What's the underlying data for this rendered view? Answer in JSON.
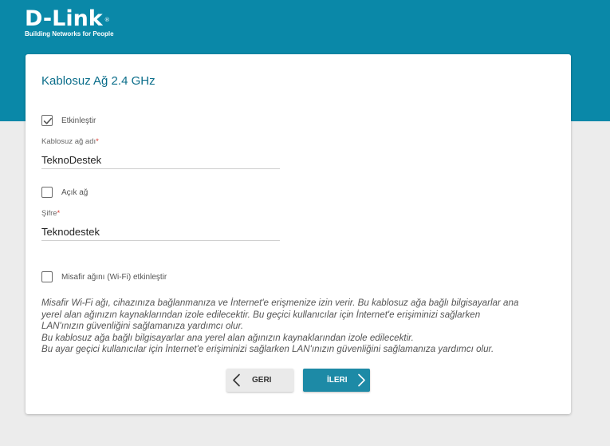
{
  "brand": {
    "logo_text": "D-Link",
    "registered_mark": "®",
    "tagline": "Building Networks for People"
  },
  "wizard": {
    "title": "Kablosuz Ağ 2.4 GHz",
    "enable": {
      "label": "Etkinleştir",
      "checked": true
    },
    "ssid": {
      "label": "Kablosuz ağ adı",
      "required_mark": "*",
      "value": "TeknoDestek"
    },
    "open_network": {
      "label": "Açık ağ",
      "checked": false
    },
    "password": {
      "label": "Şifre",
      "required_mark": "*",
      "value": "Teknodestek"
    },
    "guest_network": {
      "label": "Misafir ağını (Wi-Fi) etkinleştir",
      "checked": false
    },
    "info_lines": [
      "Misafir Wi-Fi ağı, cihazınıza bağlanmanıza ve İnternet'e erişmenize izin verir. Bu kablosuz ağa bağlı bilgisayarlar ana",
      "yerel alan ağınızın kaynaklarından izole edilecektir. Bu geçici kullanıcılar için İnternet'e erişiminizi sağlarken",
      "LAN'ınızın güvenliğini sağlamanıza yardımcı olur.",
      "Bu kablosuz ağa bağlı bilgisayarlar ana yerel alan ağınızın kaynaklarından izole edilecektir.",
      "Bu ayar geçici kullanıcılar için İnternet'e erişiminizi sağlarken LAN'ınızın güvenliğini sağlamanıza yardımcı olur."
    ],
    "buttons": {
      "back_label": "GERI",
      "next_label": "İLERI"
    }
  },
  "colors": {
    "brand_band": "#0a88a8",
    "title": "#0a6d8a",
    "next_button": "#1d8aa6",
    "required": "#d9382e"
  },
  "icons": {
    "checkmark": "check-icon",
    "back": "chevron-left-icon",
    "next": "chevron-right-icon"
  }
}
